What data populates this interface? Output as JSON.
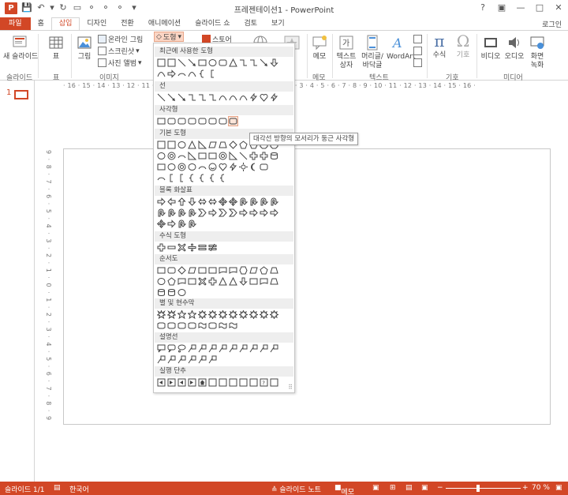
{
  "app": {
    "title": "프레젠테이션1 - PowerPoint",
    "logo": "P",
    "accent_color": "#d24726"
  },
  "quick_access": [
    "save-icon",
    "undo-icon",
    "redo-icon",
    "start-presentation-icon",
    "customize-icon"
  ],
  "window_controls": {
    "help": "?",
    "ribbon_options": "▣",
    "minimize": "—",
    "maximize": "□",
    "close": "✕"
  },
  "tabs": [
    {
      "label": "파일"
    },
    {
      "label": "홈"
    },
    {
      "label": "삽입"
    },
    {
      "label": "디자인"
    },
    {
      "label": "전환"
    },
    {
      "label": "애니메이션"
    },
    {
      "label": "슬라이드 쇼"
    },
    {
      "label": "검토"
    },
    {
      "label": "보기"
    }
  ],
  "signin_label": "로그인",
  "ribbon": {
    "new_slide": "새 슬라이드",
    "table": "표",
    "picture": "그림",
    "online_pictures": "온라인 그림",
    "screenshot": "스크린샷",
    "photo_album": "사진 앨범",
    "shapes_label": "도형",
    "store_label": "스토어",
    "memo": "메모",
    "textbox": "텍스트 상자",
    "header_footer": "머리글/ 바닥글",
    "wordart": "WordArt",
    "equation": "수식",
    "symbol": "기호",
    "video": "비디오",
    "audio": "오디오",
    "screen_recording": "화면 녹화",
    "groups": {
      "slides": "슬라이드",
      "tables": "표",
      "images": "이미지",
      "comments": "메모",
      "text": "텍스트",
      "symbols": "기호",
      "media": "미디어"
    }
  },
  "shapes_menu": {
    "sections": [
      {
        "title": "최근에 사용한 도형"
      },
      {
        "title": "선"
      },
      {
        "title": "사각형"
      },
      {
        "title": "기본 도형"
      },
      {
        "title": "블록 화살표"
      },
      {
        "title": "수식 도형"
      },
      {
        "title": "순서도"
      },
      {
        "title": "별 및 현수막"
      },
      {
        "title": "설명선"
      },
      {
        "title": "실행 단추"
      }
    ],
    "tooltip": "대각선 방향의 모서리가 둥근 사각형"
  },
  "ruler": {
    "ticks": "· 16 · 15 · 14 · 13 · 12 · 11 · 10 · 9 · 8 · 7 · 6 · 5 · 4 · 3 · 2 · 1 · 0 · 1 · 2 · 3 · 4 · 5 · 6 · 7 · 8 · 9 · 10 · 11 · 12 · 13 · 14 · 15 · 16 ·",
    "vticks": "9 · 8 · 7 · 6 · 5 · 4 · 3 · 2 · 1 · 0 · 1 · 2 · 3 · 4 · 5 · 6 · 7 · 8 · 9"
  },
  "thumbnails": {
    "number": "1"
  },
  "status": {
    "slide_info": "슬라이드 1/1",
    "language": "한국어",
    "notes": "≙ 슬라이드 노트",
    "comments": "메모",
    "zoom": "70 %",
    "zoom_level": 0.7
  }
}
